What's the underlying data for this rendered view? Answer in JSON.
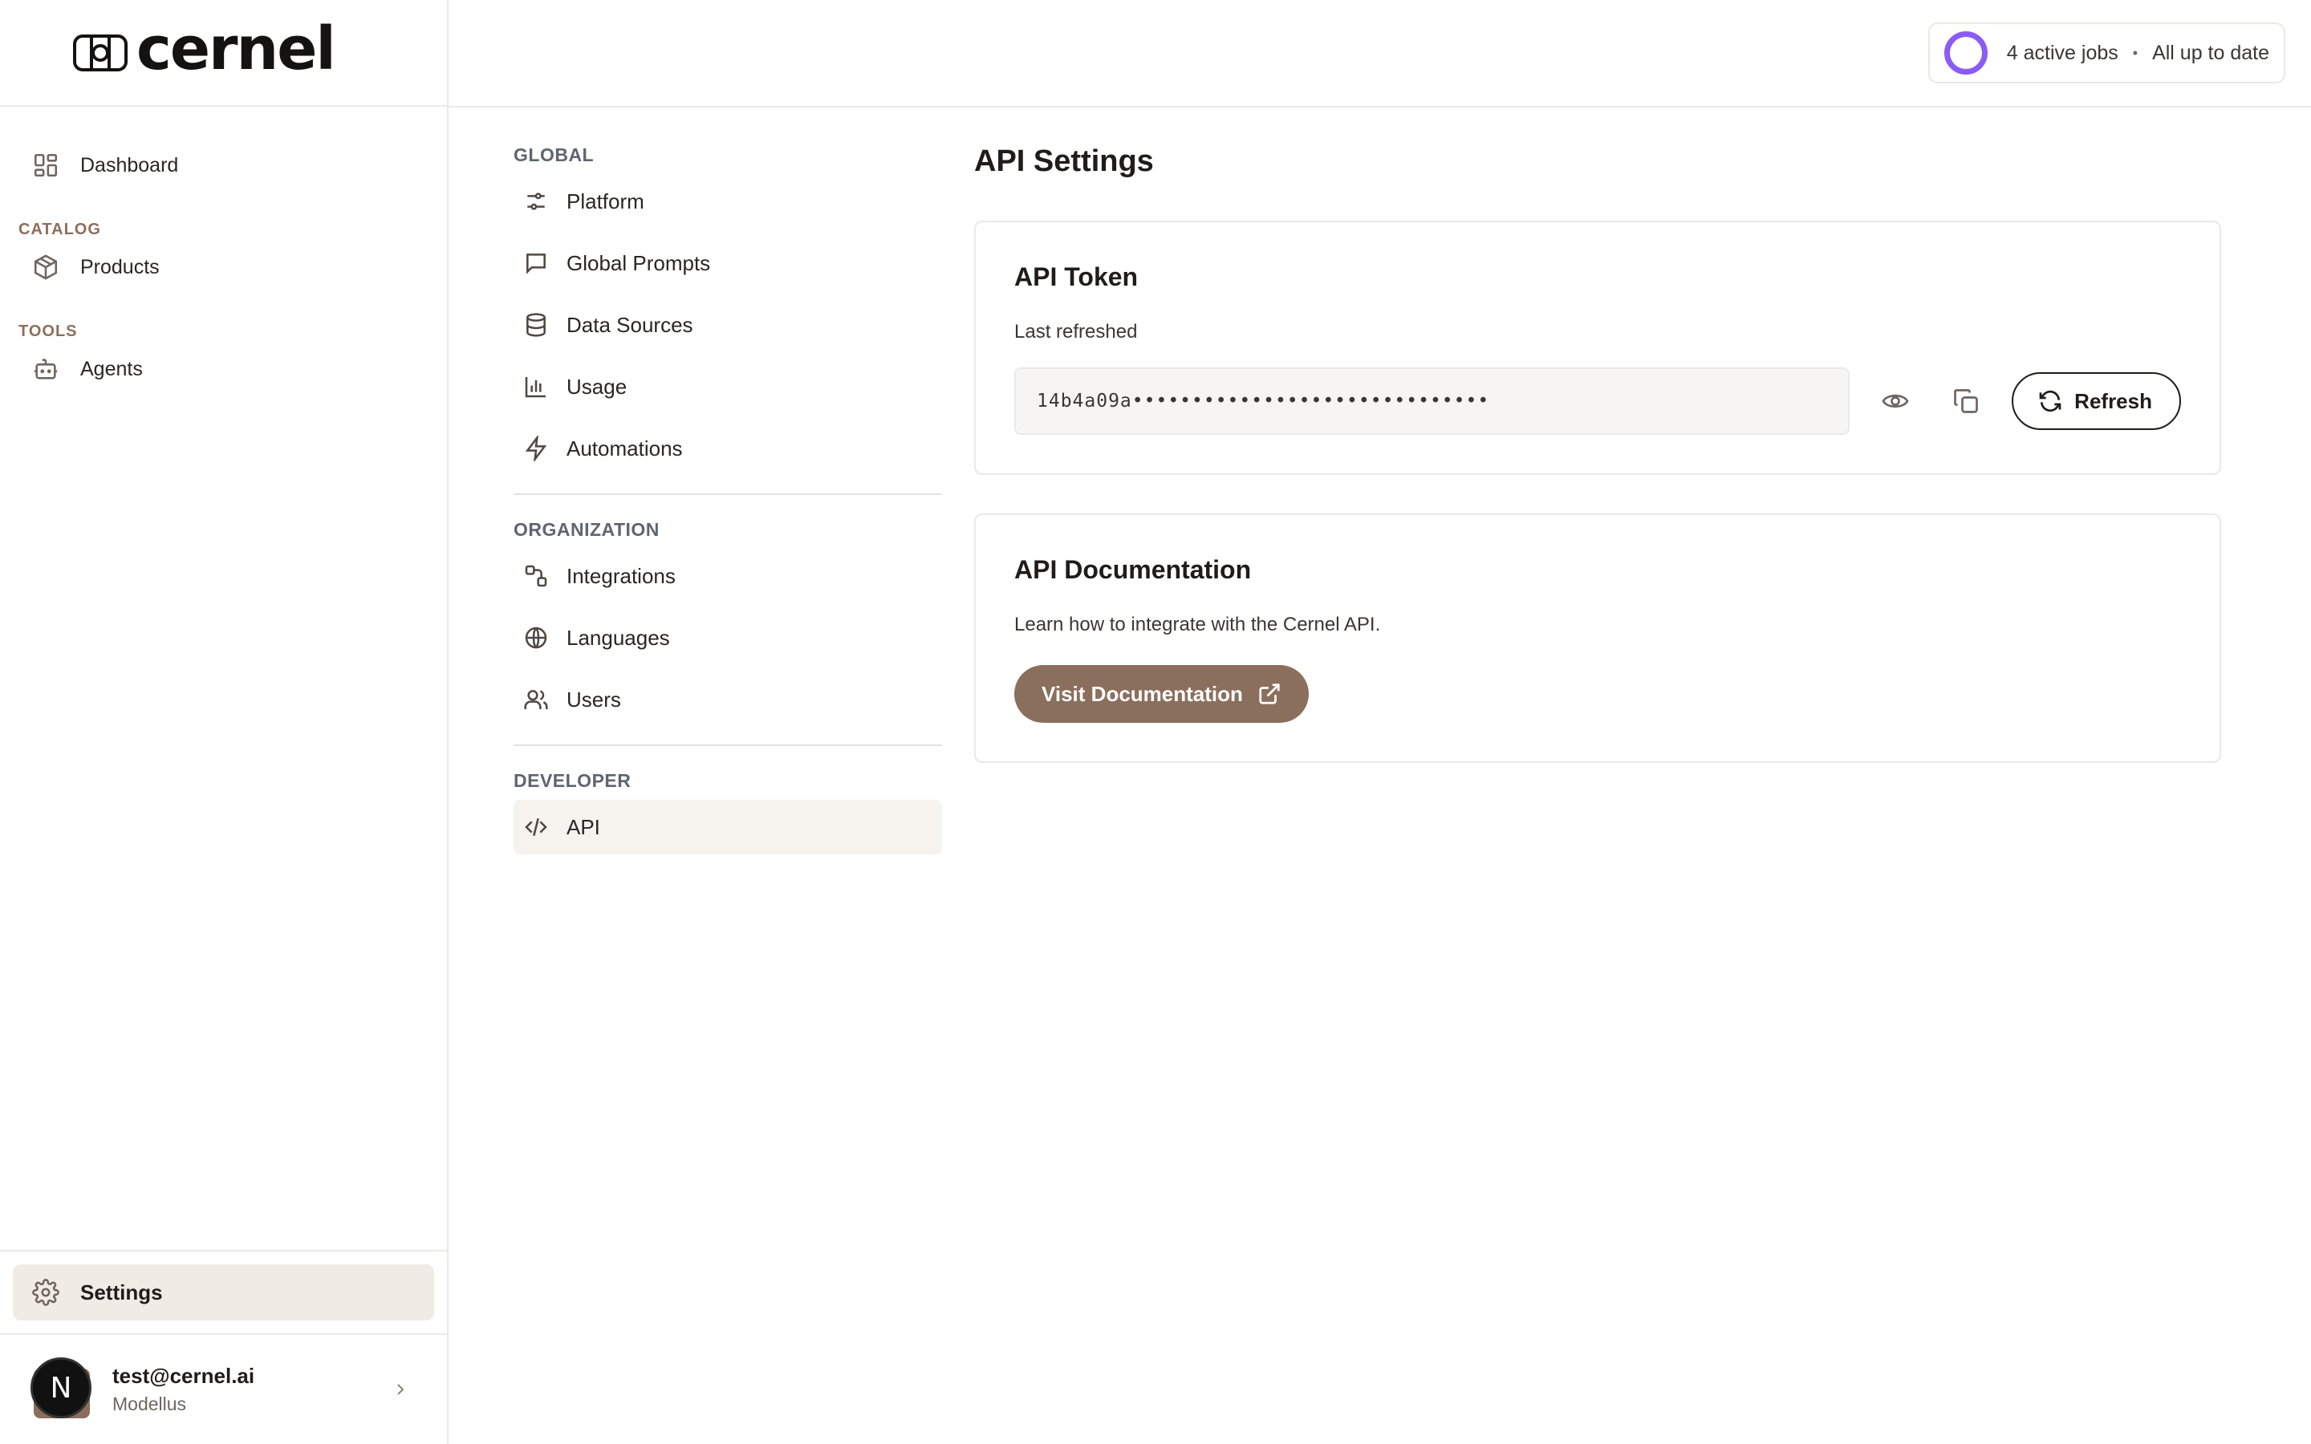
{
  "brand": {
    "name": "cernel"
  },
  "sidebar": {
    "dashboard": {
      "label": "Dashboard",
      "icon": "dashboard-icon"
    },
    "sections": [
      {
        "title": "CATALOG",
        "items": [
          {
            "label": "Products",
            "icon": "box-icon"
          }
        ]
      },
      {
        "title": "TOOLS",
        "items": [
          {
            "label": "Agents",
            "icon": "bot-icon"
          }
        ]
      }
    ],
    "settings": {
      "label": "Settings",
      "icon": "gear-icon"
    },
    "user": {
      "email": "test@cernel.ai",
      "org": "Modellus",
      "avatar_letter": "N"
    }
  },
  "topbar": {
    "jobs": "4 active jobs",
    "separator": "•",
    "status": "All up to date",
    "accent": "#8b5cf6"
  },
  "subnav": {
    "global": {
      "title": "GLOBAL",
      "items": [
        "Platform",
        "Global Prompts",
        "Data Sources",
        "Usage",
        "Automations"
      ]
    },
    "organization": {
      "title": "ORGANIZATION",
      "items": [
        "Integrations",
        "Languages",
        "Users"
      ]
    },
    "developer": {
      "title": "DEVELOPER",
      "items": [
        "API"
      ]
    },
    "active": "API"
  },
  "main": {
    "title": "API Settings",
    "token_card": {
      "title": "API Token",
      "label": "Last refreshed",
      "token": "14b4a09a••••••••••••••••••••••••••••••",
      "refresh_label": "Refresh"
    },
    "docs_card": {
      "title": "API Documentation",
      "description": "Learn how to integrate with the Cernel API.",
      "button_label": "Visit Documentation",
      "button_color": "#8b6f5d"
    }
  }
}
